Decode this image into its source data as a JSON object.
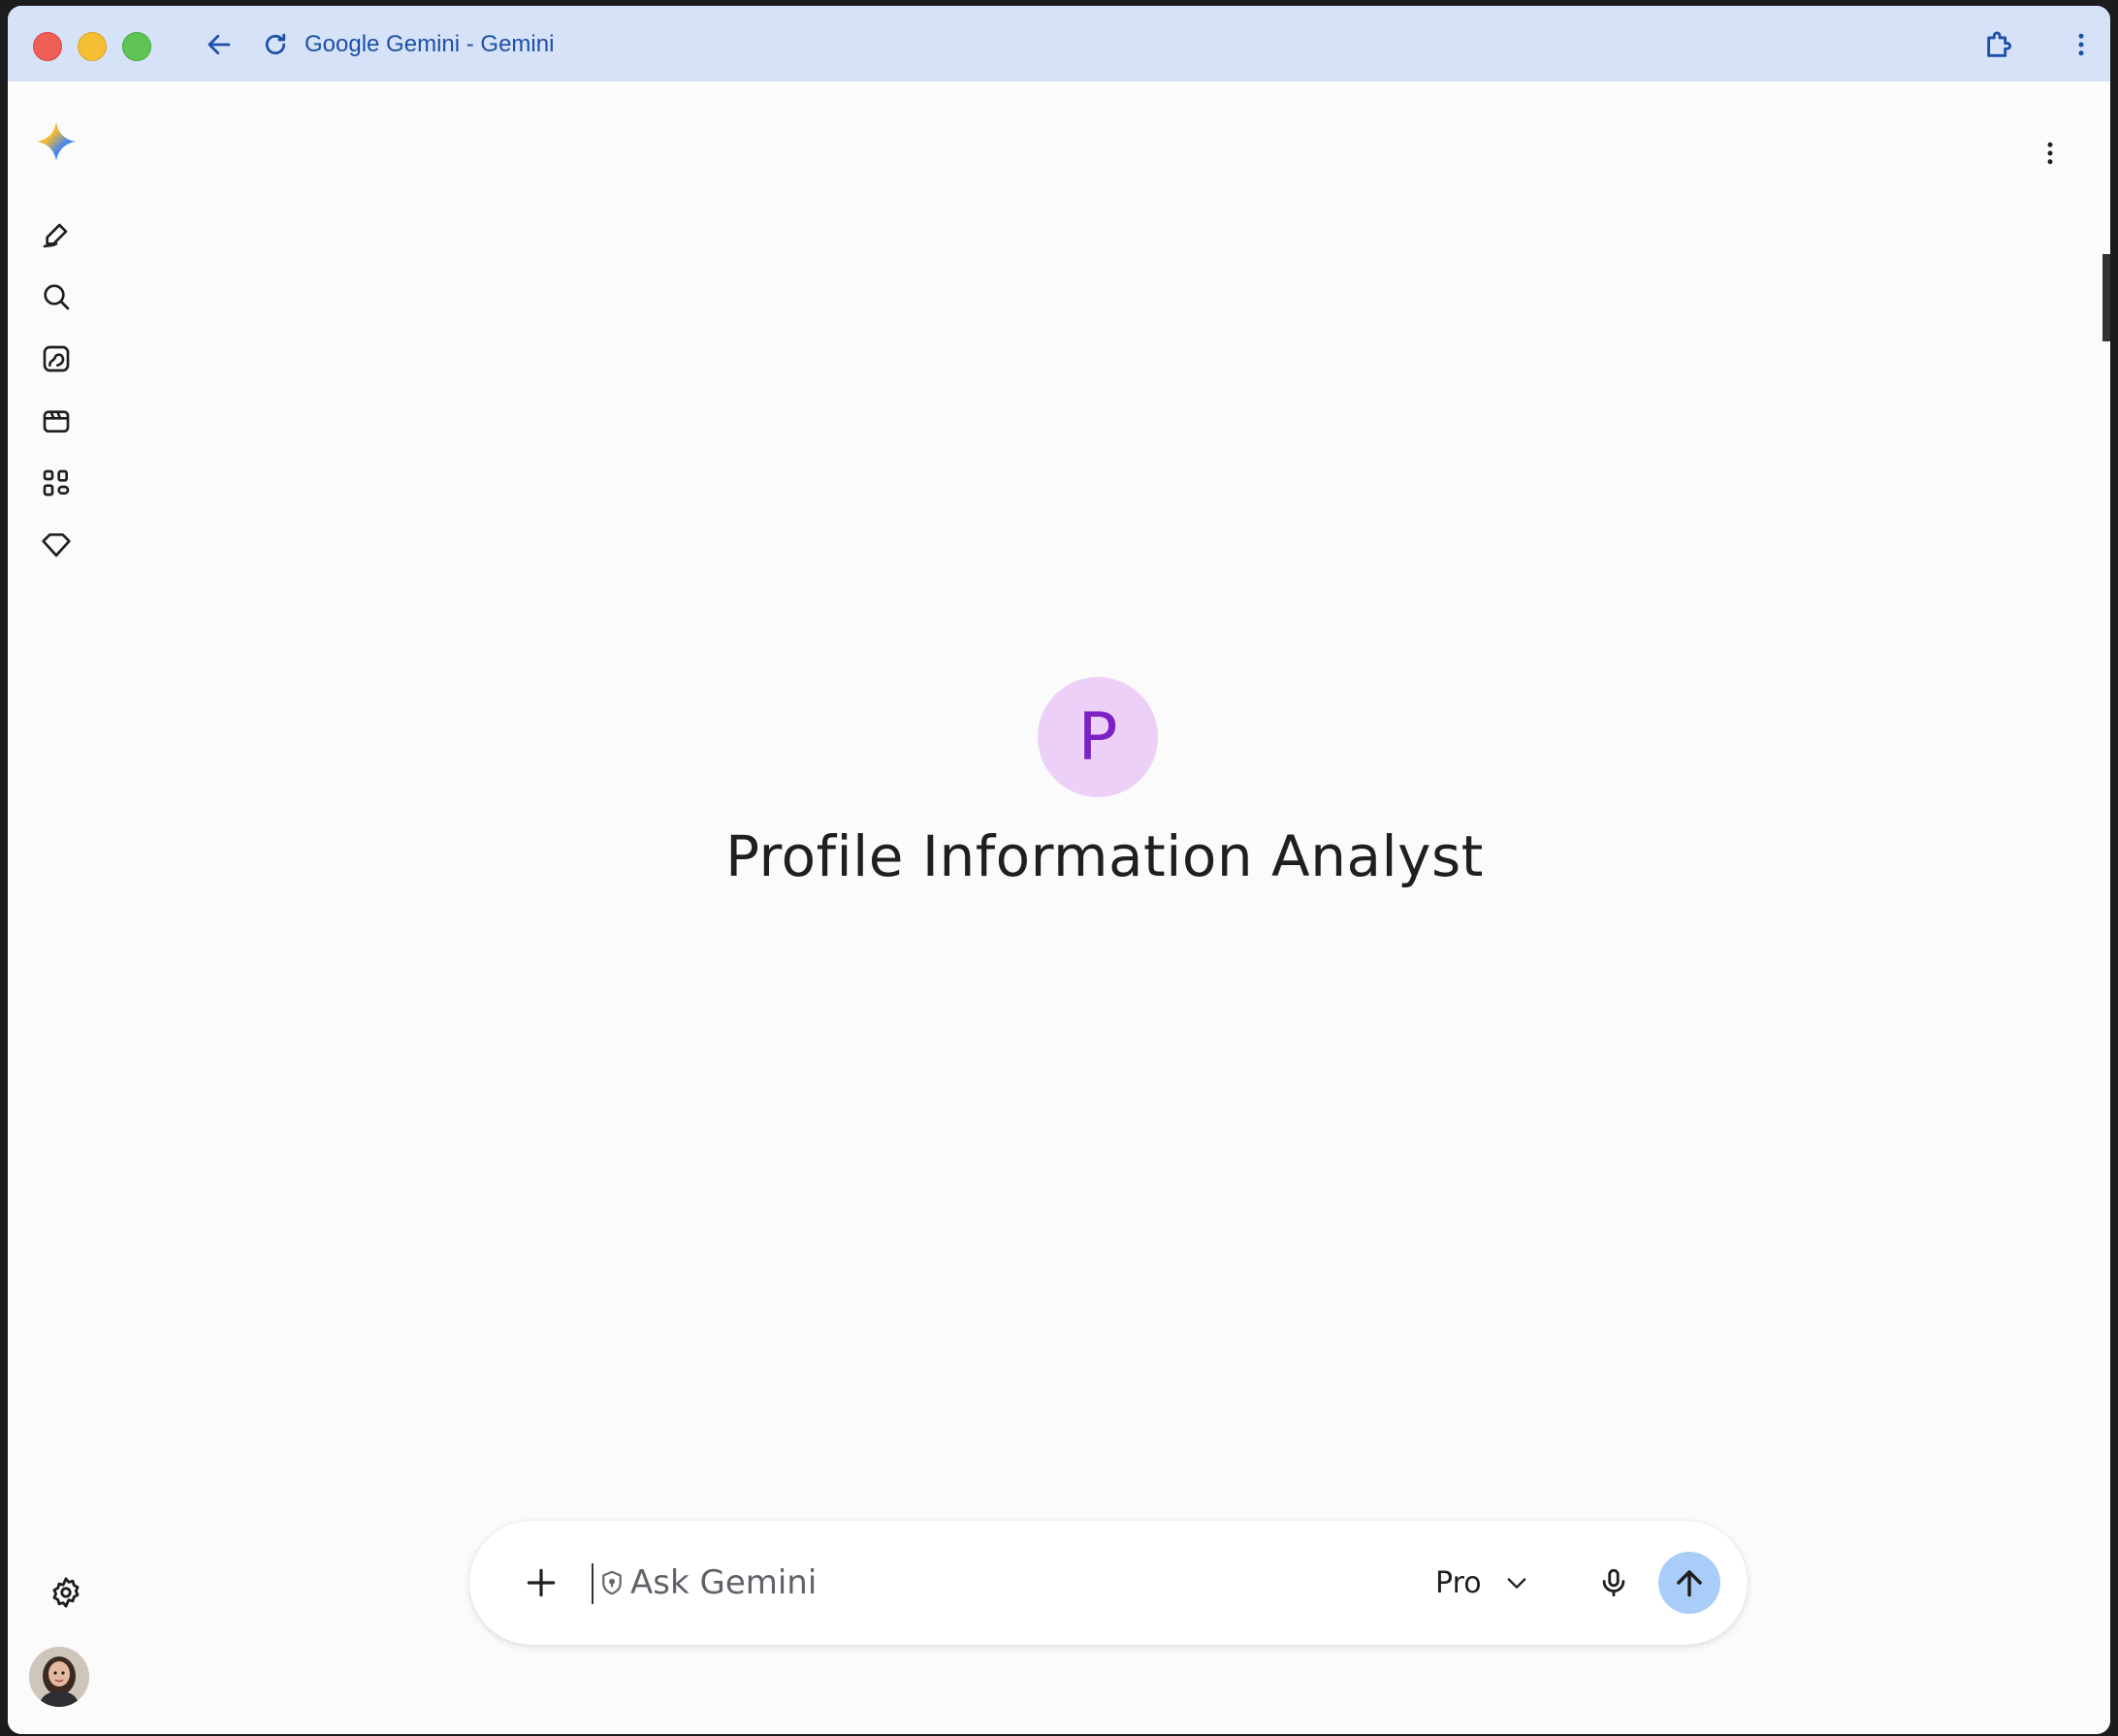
{
  "window": {
    "tab_title": "Google Gemini - Gemini"
  },
  "gem": {
    "initial": "P",
    "name": "Profile Information Analyst",
    "avatar_bg": "#ecd0f8",
    "avatar_fg": "#7c22c4"
  },
  "sidebar": {
    "items": [
      {
        "icon": "new-chat-icon"
      },
      {
        "icon": "search-icon"
      },
      {
        "icon": "image-gallery-icon"
      },
      {
        "icon": "video-clapper-icon"
      },
      {
        "icon": "apps-icon"
      },
      {
        "icon": "gem-diamond-icon"
      }
    ],
    "bottom": [
      {
        "icon": "settings-gear-icon"
      },
      {
        "icon": "account-avatar"
      }
    ]
  },
  "composer": {
    "placeholder": "Ask Gemini",
    "model": "Pro",
    "accent": "#a8cdf8"
  }
}
